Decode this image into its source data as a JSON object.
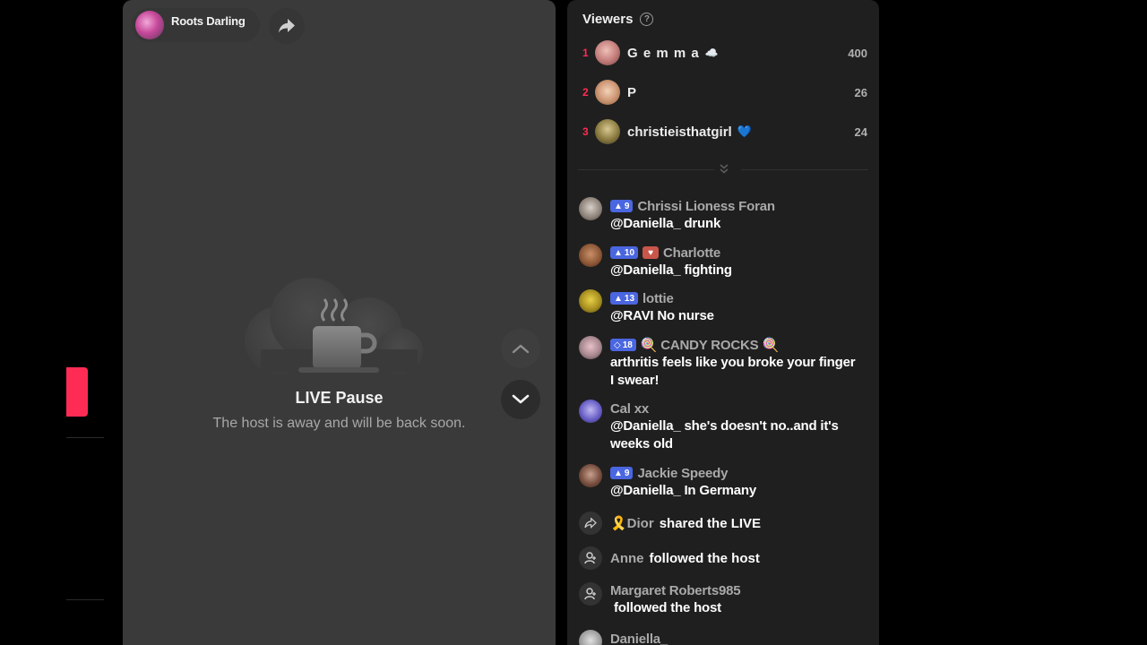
{
  "host": {
    "name": "Roots Darling"
  },
  "pause": {
    "title": "LIVE Pause",
    "subtitle": "The host is away and will be back soon."
  },
  "viewers": {
    "title": "Viewers",
    "help_glyph": "?",
    "top": [
      {
        "rank": "1",
        "name": "G e m m a",
        "emoji": "☁️",
        "score": "400"
      },
      {
        "rank": "2",
        "name": "P",
        "emoji": "",
        "score": "26"
      },
      {
        "rank": "3",
        "name": "christieisthatgirl",
        "emoji": "💙",
        "score": "24"
      }
    ]
  },
  "chat": [
    {
      "user": "Chrissi Lioness Foran",
      "badge": "9",
      "text": "@Daniella_ drunk"
    },
    {
      "user": "Charlotte",
      "badge": "10",
      "text": "@Daniella_ fighting"
    },
    {
      "user": "lottie",
      "badge": "13",
      "text": "@RAVI No nurse"
    },
    {
      "user": "🍭 CANDY ROCKS 🍭",
      "badge": "18",
      "text": "arthritis feels like you broke your finger I swear!"
    },
    {
      "user": "Cal xx",
      "text": "@Daniella_ she's doesn't no..and it's weeks old"
    },
    {
      "user": "Jackie Speedy",
      "badge": "9",
      "text": "@Daniella_ In Germany"
    },
    {
      "user": "🎗️Dior",
      "text": "shared the LIVE"
    },
    {
      "user": "Anne",
      "text": "followed the host"
    },
    {
      "user": "Margaret Roberts985",
      "text": "followed the host"
    },
    {
      "user": "Daniella_"
    }
  ],
  "colors": {
    "accent": "#fe2c55",
    "badge_blue": "#4a66e0",
    "panel_bg": "#1f1f1f",
    "video_bg": "#3a3a3a"
  }
}
